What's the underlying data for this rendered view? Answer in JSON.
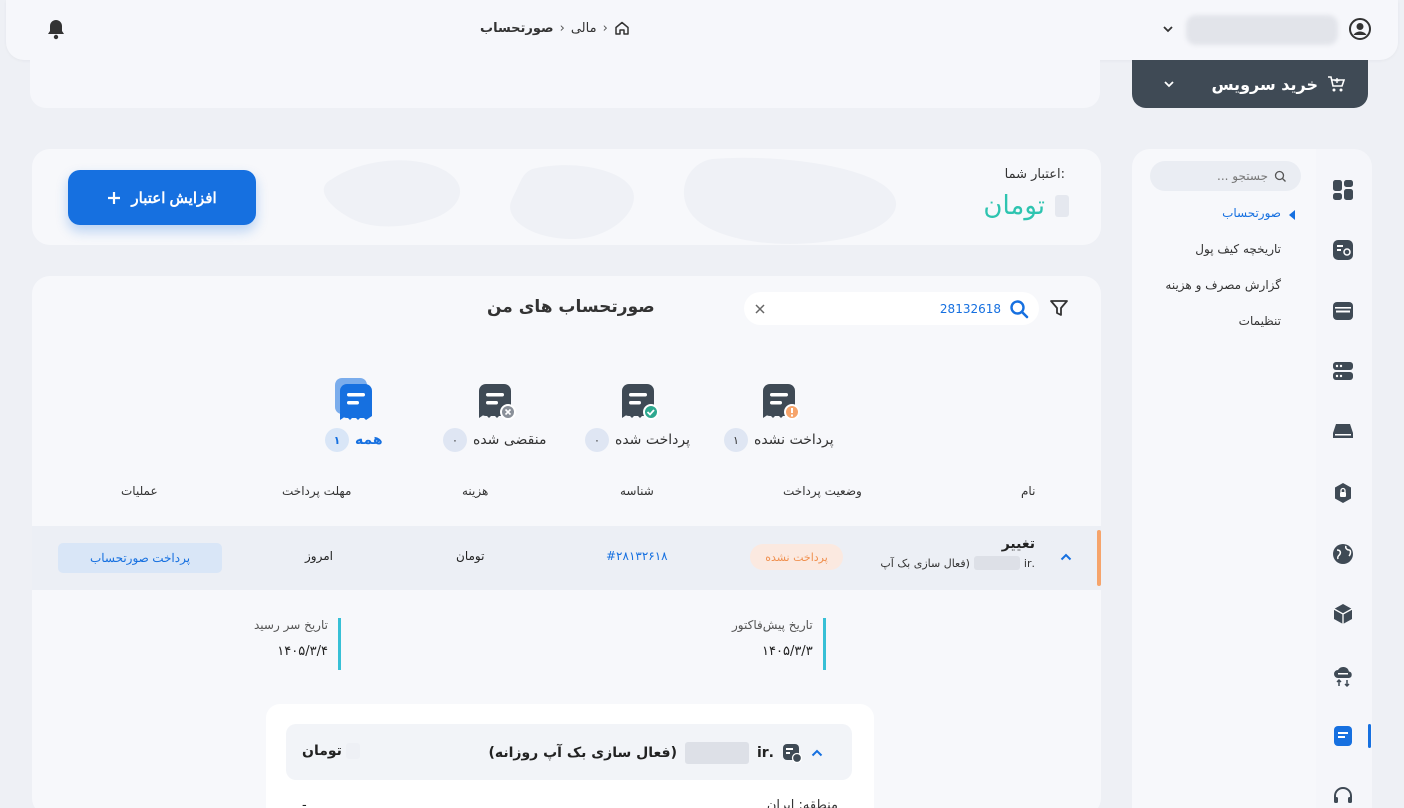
{
  "header": {
    "breadcrumb": [
      "صورتحساب",
      "مالی"
    ],
    "user_name": ""
  },
  "buy_service": {
    "label": "خرید سرویس"
  },
  "credit": {
    "title": "اعتبار شما:",
    "currency": "تومان",
    "add_button": "افزایش اعتبار"
  },
  "invoices": {
    "title": "صورتحساب های من",
    "search_value": "28132618",
    "tabs": [
      {
        "label": "پرداخت نشده",
        "count": "۱"
      },
      {
        "label": "پرداخت شده",
        "count": "۰"
      },
      {
        "label": "منقضی شده",
        "count": "۰"
      },
      {
        "label": "همه",
        "count": "۱"
      }
    ],
    "columns": [
      "نام",
      "وضعیت پرداخت",
      "شناسه",
      "هزینه",
      "مهلت پرداخت",
      "عملیات"
    ],
    "row": {
      "name": "تغییر",
      "sub_ext": ".ir",
      "sub_desc": "(فعال سازی بک آپ",
      "status": "پرداخت نشده",
      "id": "#۲۸۱۳۲۶۱۸",
      "cost": "تومان",
      "due": "امروز",
      "pay_button": "پرداخت صورتحساب"
    },
    "dates": {
      "proforma_label": "تاریخ پیش‌فاکتور",
      "proforma_value": "۱۴۰۵/۳/۳",
      "due_label": "تاریخ سر رسید",
      "due_value": "۱۴۰۵/۳/۴"
    },
    "detail": {
      "ext": ".ir",
      "desc": "(فعال سازی بک آپ روزانه)",
      "price_currency": "تومان",
      "region": "منطقه: ایران",
      "dash": "-"
    }
  },
  "sidebar": {
    "search_placeholder": "جستجو ...",
    "items": [
      {
        "label": "صورتحساب",
        "active": true
      },
      {
        "label": "تاریخچه کیف پول",
        "active": false
      },
      {
        "label": "گزارش مصرف و هزینه",
        "active": false
      },
      {
        "label": "تنظیمات",
        "active": false
      }
    ]
  },
  "icons": {
    "rail": [
      "dashboard-icon",
      "document-icon",
      "browser-icon",
      "server-icon",
      "cloud-server-icon",
      "lock-icon",
      "globe-icon",
      "box-icon",
      "cloud-transfer-icon",
      "invoice-icon",
      "headset-icon"
    ]
  },
  "colors": {
    "primary": "#1670e0",
    "accent_teal": "#2ec4b0",
    "warning": "#f0904f",
    "dark": "#3f4a55"
  }
}
